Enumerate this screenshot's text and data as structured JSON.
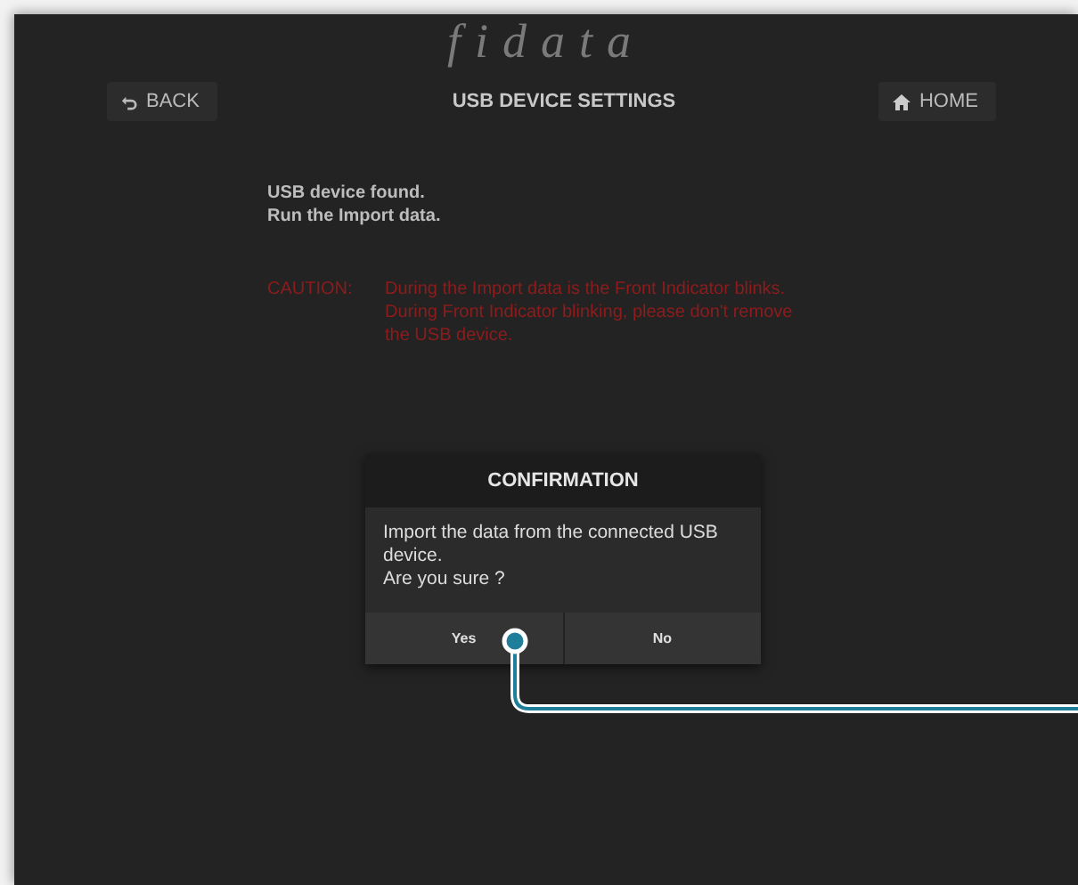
{
  "logo": "fidata",
  "header": {
    "back_button": "BACK",
    "title": "USB DEVICE SETTINGS",
    "home_button": "HOME"
  },
  "message": [
    "USB device found.",
    "Run the Import data."
  ],
  "caution": {
    "label": "CAUTION:",
    "text": "During the Import data is the Front Indicator blinks.\nDuring Front Indicator blinking, please don't remove\nthe USB device."
  },
  "dialog": {
    "title": "CONFIRMATION",
    "message": "Import the data from the connected USB\ndevice.\nAre you sure ?",
    "buttons": [
      "Yes",
      "No"
    ]
  }
}
